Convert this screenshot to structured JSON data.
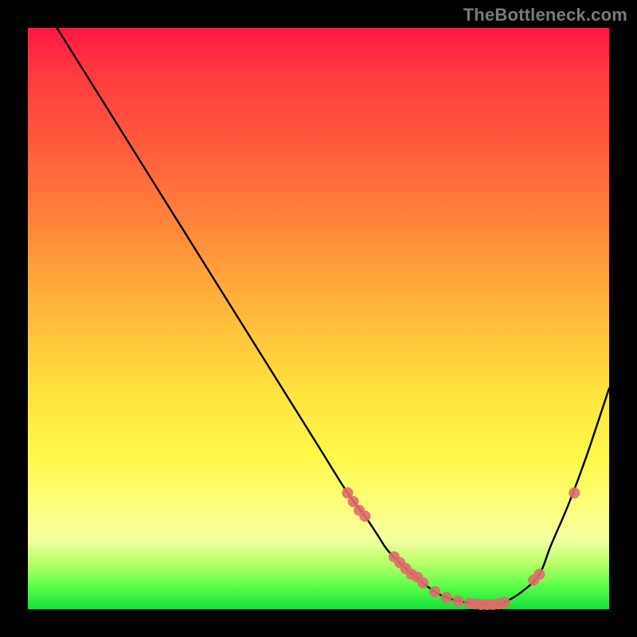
{
  "watermark": "TheBottleneck.com",
  "chart_data": {
    "type": "line",
    "title": "",
    "xlabel": "",
    "ylabel": "",
    "xlim": [
      0,
      100
    ],
    "ylim": [
      0,
      100
    ],
    "series": [
      {
        "name": "curve",
        "x": [
          5,
          10,
          15,
          20,
          25,
          30,
          35,
          40,
          45,
          50,
          55,
          58,
          60,
          62,
          65,
          68,
          70,
          72,
          75,
          78,
          80,
          82,
          85,
          88,
          90,
          93,
          96,
          100
        ],
        "values": [
          100,
          92,
          84,
          76,
          68,
          60,
          52,
          44,
          36,
          28,
          20,
          16,
          13,
          10,
          7,
          4.5,
          3,
          2,
          1.2,
          0.8,
          0.8,
          1.2,
          3,
          6,
          11,
          18,
          26,
          38
        ]
      },
      {
        "name": "markers",
        "x": [
          55,
          56,
          57,
          58,
          63,
          64,
          65,
          66,
          67,
          68,
          70,
          72,
          74,
          76,
          77,
          78,
          79,
          80,
          81,
          82,
          87,
          88,
          94
        ],
        "values": [
          20,
          18.5,
          17,
          16,
          9,
          8,
          7,
          6,
          5.5,
          4.5,
          3,
          2,
          1.4,
          1,
          0.9,
          0.8,
          0.8,
          0.8,
          0.9,
          1.2,
          5,
          6,
          20
        ]
      }
    ],
    "annotations": []
  },
  "colors": {
    "curve_stroke": "#000000",
    "marker_fill": "#e06c6c"
  }
}
